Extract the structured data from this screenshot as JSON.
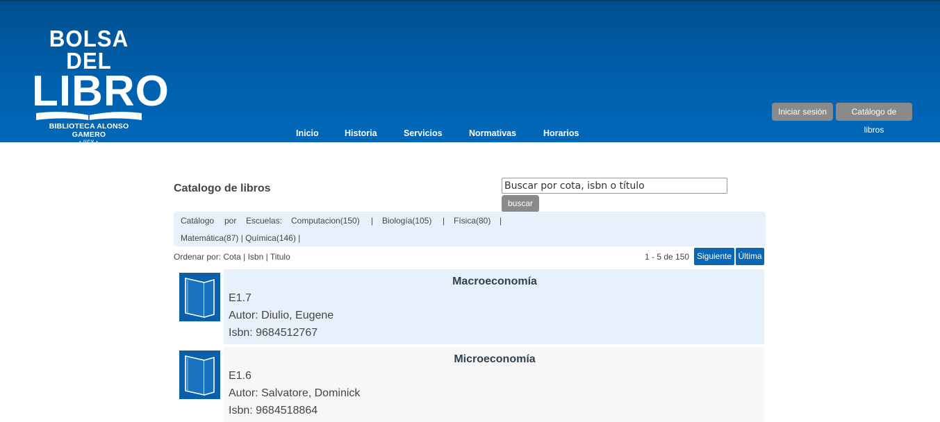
{
  "header": {
    "logo": {
      "line1": "BOLSA DEL",
      "line2": "LIBRO",
      "line3": "BIBLIOTECA ALONSO GAMERO",
      "line4": "• UCV •"
    },
    "login_label": "Iniciar sesión",
    "catalog_label": "Catálogo de libros",
    "nav": [
      "Inicio",
      "Historia",
      "Servicios",
      "Normativas",
      "Horarios"
    ]
  },
  "main": {
    "title": "Catalogo de libros",
    "search": {
      "value": "Buscar por cota, isbn o título",
      "button_label": "buscar"
    },
    "schools": {
      "prefix_words": [
        "Catálogo",
        "por",
        "Escuelas:"
      ],
      "row1": [
        "Computacion(150)",
        "|",
        "Biología(105)",
        "|",
        "Física(80)",
        "|"
      ],
      "row2": "Matemática(87) | Química(146) |"
    },
    "sort": {
      "label": "Ordenar por:",
      "options": [
        "Cota",
        "Isbn",
        "Titulo"
      ],
      "separator": "|"
    },
    "pagination": {
      "info": "1 - 5 de 150",
      "next_label": "Siguiente",
      "last_label": "Última"
    },
    "books": [
      {
        "title": "Macroeconomía",
        "cota": "E1.7",
        "author": "Autor: Diulio, Eugene",
        "isbn": "Isbn: 9684512767"
      },
      {
        "title": "Microeconomía",
        "cota": "E1.6",
        "author": "Autor: Salvatore, Dominick",
        "isbn": "Isbn: 9684518864"
      }
    ]
  },
  "colors": {
    "header_blue": "#0060ad",
    "button_gray": "#8a8a8a",
    "pagination_blue": "#0a67b5",
    "row_highlight": "#e8f1fb"
  }
}
